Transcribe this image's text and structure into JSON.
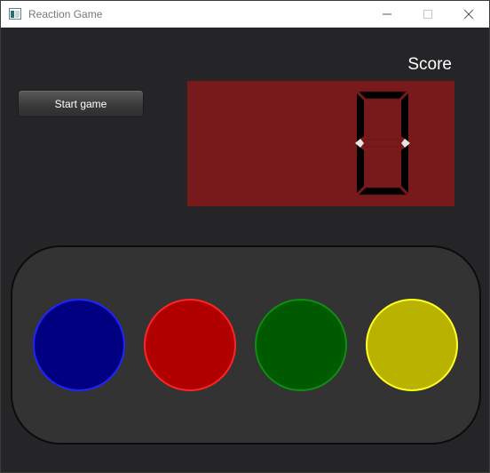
{
  "window": {
    "title": "Reaction Game",
    "min_icon": "minimize-icon",
    "max_icon": "maximize-icon",
    "close_icon": "close-icon"
  },
  "controls": {
    "start_label": "Start game"
  },
  "score": {
    "label": "Score",
    "value": "0",
    "panel_color": "#781a1c"
  },
  "pads": [
    {
      "name": "blue",
      "fill": "#000080",
      "border": "#1f24ff"
    },
    {
      "name": "red",
      "fill": "#b00000",
      "border": "#ff2424"
    },
    {
      "name": "green",
      "fill": "#005a00",
      "border": "#0f8f0f"
    },
    {
      "name": "yellow",
      "fill": "#b9b300",
      "border": "#ffff26"
    }
  ]
}
